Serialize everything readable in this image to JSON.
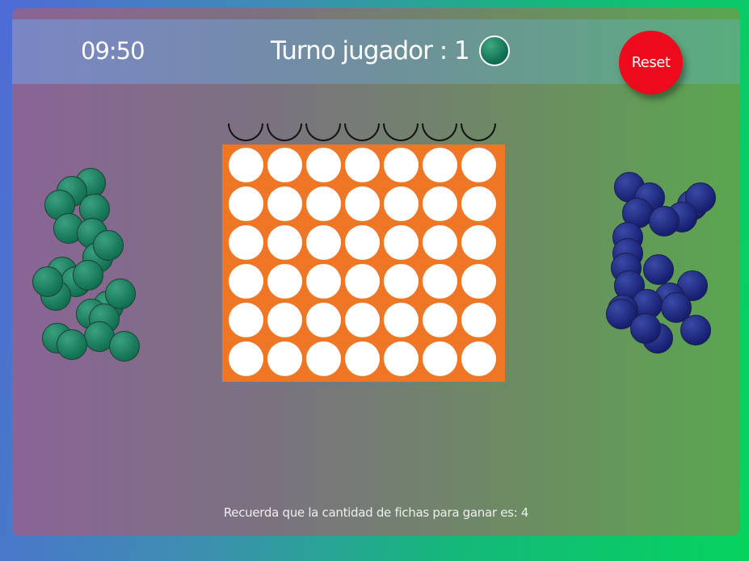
{
  "header": {
    "timer": "09:50",
    "turn_label": "Turno jugador : 1",
    "current_player_chip": "green",
    "reset_label": "Reset"
  },
  "board": {
    "columns": 7,
    "rows": 6,
    "board_color": "#ee7625",
    "cells": "empty"
  },
  "players": {
    "player1": {
      "color": "#117a57",
      "chips_remaining": 21
    },
    "player2": {
      "color": "#1c2679",
      "chips_remaining": 21
    }
  },
  "footer": {
    "message": "Recuerda que la cantidad de fichas para ganar es: 4"
  }
}
